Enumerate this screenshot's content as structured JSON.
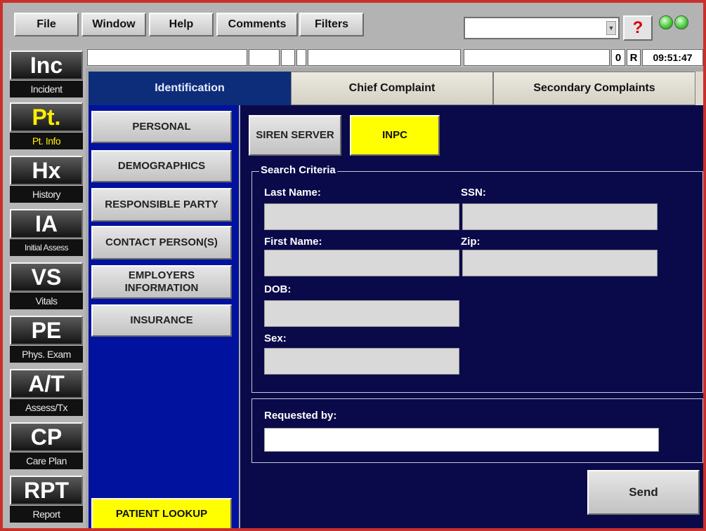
{
  "menu": {
    "items": [
      "File",
      "Window",
      "Help",
      "Comments",
      "Filters"
    ],
    "combo_value": "",
    "help_label": "?"
  },
  "status": {
    "counter": "0",
    "mode": "R",
    "time": "09:51:47"
  },
  "nav": [
    {
      "code": "Inc",
      "label": "Incident",
      "active": false
    },
    {
      "code": "Pt.",
      "label": "Pt. Info",
      "active": true
    },
    {
      "code": "Hx",
      "label": "History",
      "active": false
    },
    {
      "code": "IA",
      "label": "Initial Assess",
      "active": false
    },
    {
      "code": "VS",
      "label": "Vitals",
      "active": false
    },
    {
      "code": "PE",
      "label": "Phys. Exam",
      "active": false
    },
    {
      "code": "A/T",
      "label": "Assess/Tx",
      "active": false
    },
    {
      "code": "CP",
      "label": "Care Plan",
      "active": false
    },
    {
      "code": "RPT",
      "label": "Report",
      "active": false
    }
  ],
  "tabs": [
    {
      "label": "Identification",
      "active": true
    },
    {
      "label": "Chief Complaint",
      "active": false
    },
    {
      "label": "Secondary Complaints",
      "active": false
    }
  ],
  "sections": [
    "PERSONAL",
    "DEMOGRAPHICS",
    "RESPONSIBLE PARTY",
    "CONTACT PERSON(S)",
    "EMPLOYERS INFORMATION",
    "INSURANCE"
  ],
  "patient_lookup_label": "PATIENT LOOKUP",
  "sources": {
    "siren": "SIREN SERVER",
    "inpc": "INPC"
  },
  "search": {
    "legend": "Search Criteria",
    "last_name_label": "Last Name:",
    "ssn_label": "SSN:",
    "first_name_label": "First Name:",
    "zip_label": "Zip:",
    "dob_label": "DOB:",
    "sex_label": "Sex:",
    "last_name_value": "",
    "ssn_value": "",
    "first_name_value": "",
    "zip_value": "",
    "dob_value": "",
    "sex_value": ""
  },
  "requested": {
    "label": "Requested by:",
    "value": ""
  },
  "send_label": "Send",
  "colors": {
    "accent_yellow": "#ffff00",
    "tab_active": "#0d2d7a",
    "panel_blue": "#00129e",
    "main_navy": "#0a0a4a"
  }
}
